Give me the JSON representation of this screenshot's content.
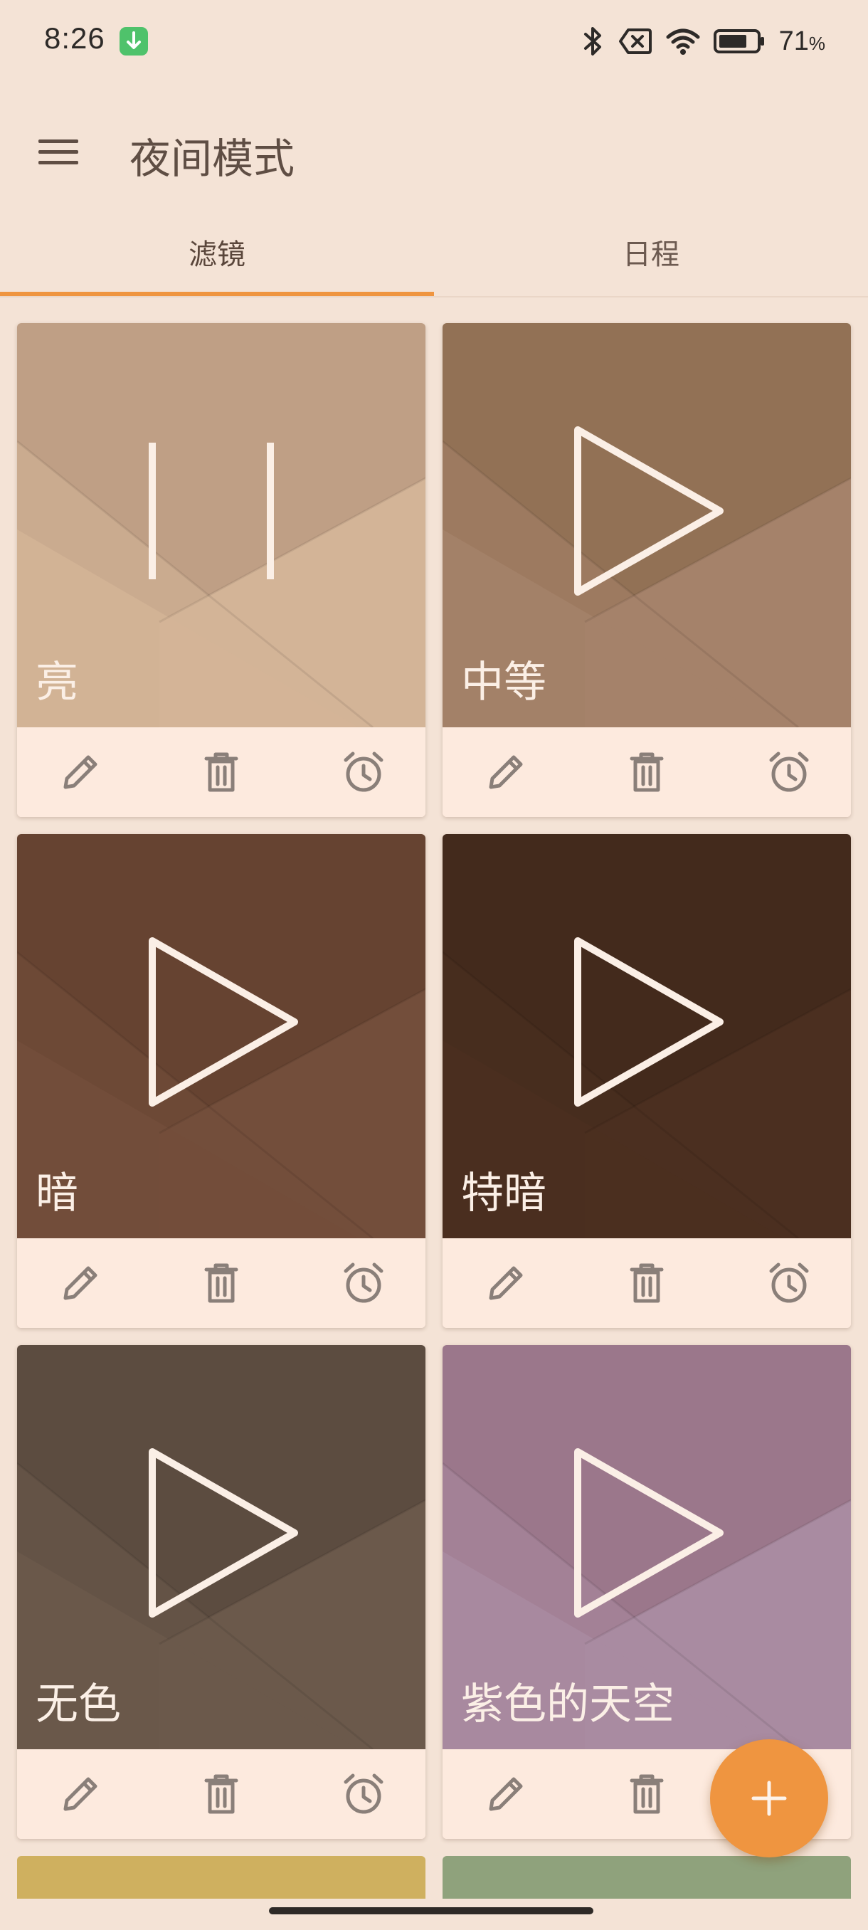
{
  "status_bar": {
    "time": "8:26",
    "battery_percent": "71",
    "battery_unit": "%",
    "icons": [
      "download-notification-icon",
      "bluetooth-icon",
      "no-sim-icon",
      "wifi-icon",
      "battery-icon"
    ]
  },
  "app_bar": {
    "title": "夜间模式",
    "menu_icon": "hamburger-menu-icon"
  },
  "tabs": [
    {
      "label": "滤镜",
      "active": true
    },
    {
      "label": "日程",
      "active": false
    }
  ],
  "colors": {
    "accent": "#ef9540",
    "background": "#f4e3d6",
    "card_footer": "#fdeade",
    "icon_gray": "#8a7f79"
  },
  "filters": [
    {
      "label": "亮",
      "state": "playing",
      "color_top": "#bf9f85",
      "color_bottom": "#d3b497"
    },
    {
      "label": "中等",
      "state": "paused",
      "color_top": "#927155",
      "color_bottom": "#a5826a"
    },
    {
      "label": "暗",
      "state": "paused",
      "color_top": "#664331",
      "color_bottom": "#734e3b"
    },
    {
      "label": "特暗",
      "state": "paused",
      "color_top": "#432a1c",
      "color_bottom": "#4b2f20"
    },
    {
      "label": "无色",
      "state": "paused",
      "color_top": "#5c4c40",
      "color_bottom": "#6b594b"
    },
    {
      "label": "紫色的天空",
      "state": "paused",
      "color_top": "#9b778b",
      "color_bottom": "#a98ba1"
    }
  ],
  "peek_cards": [
    {
      "color": "#cfb05f"
    },
    {
      "color": "#8fa27c"
    }
  ],
  "fab": {
    "icon": "plus-icon"
  }
}
